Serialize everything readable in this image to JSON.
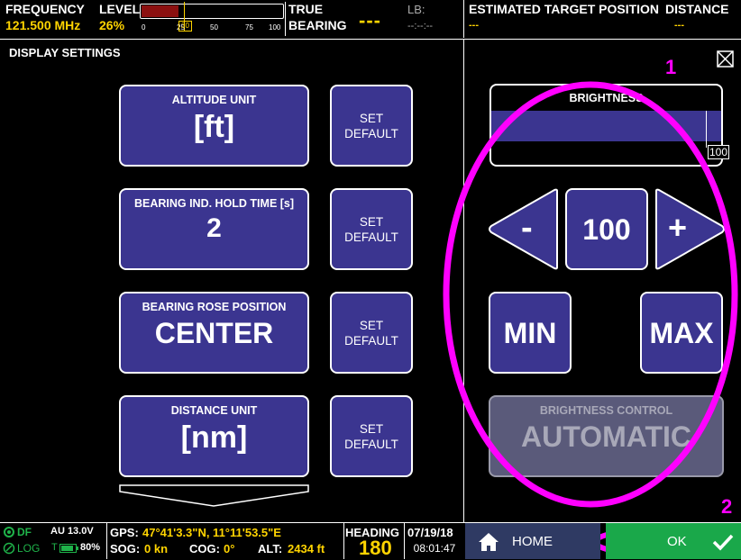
{
  "topbar": {
    "frequency_label": "FREQUENCY",
    "frequency_value": "121.500 MHz",
    "level_label": "LEVEL",
    "level_value": "26%",
    "level_fraction": 0.26,
    "level_ticks": [
      "0",
      "25",
      "50",
      "75",
      "100"
    ],
    "level_marker": "30",
    "true_label": "TRUE",
    "bearing_label": "BEARING",
    "bearing_value": "---",
    "lb_label": "LB:",
    "lb_value": "--:--:--",
    "est_label": "ESTIMATED TARGET POSITION",
    "est_value": "---",
    "distance_label": "DISTANCE",
    "distance_value": "---"
  },
  "section_title": "DISPLAY SETTINGS",
  "settings": [
    {
      "caption": "ALTITUDE UNIT",
      "value": "[ft]",
      "default_line1": "SET",
      "default_line2": "DEFAULT"
    },
    {
      "caption": "BEARING IND. HOLD TIME [s]",
      "value": "2",
      "default_line1": "SET",
      "default_line2": "DEFAULT"
    },
    {
      "caption": "BEARING ROSE POSITION",
      "value": "CENTER",
      "default_line1": "SET",
      "default_line2": "DEFAULT"
    },
    {
      "caption": "DISTANCE UNIT",
      "value": "[nm]",
      "default_line1": "SET",
      "default_line2": "DEFAULT"
    }
  ],
  "brightness": {
    "title": "BRIGHTNESS",
    "value": "100",
    "fraction": 1.0,
    "minus": "-",
    "plus": "+",
    "min": "MIN",
    "max": "MAX",
    "control_caption": "BRIGHTNESS CONTROL",
    "control_value": "AUTOMATIC"
  },
  "annotations": {
    "one": "1",
    "two": "2"
  },
  "statusbar": {
    "df": "DF",
    "log": "LOG",
    "au": "AU 13.0V",
    "t": "T",
    "battery": "80%",
    "gps_label": "GPS:",
    "gps_value": "47°41'3.3\"N, 11°11'53.5\"E",
    "sog_label": "SOG:",
    "sog_value": "0 kn",
    "cog_label": "COG:",
    "cog_value": "0°",
    "alt_label": "ALT:",
    "alt_value": "2434 ft",
    "heading_label": "HEADING",
    "heading_value": "180",
    "date": "07/19/18",
    "time": "08:01:47",
    "home_label": "HOME",
    "ok_label": "OK"
  },
  "colors": {
    "button": "#3b3590",
    "accent_yellow": "#ffd400",
    "highlight": "#ff00ff",
    "ok_green": "#1aa84a"
  }
}
